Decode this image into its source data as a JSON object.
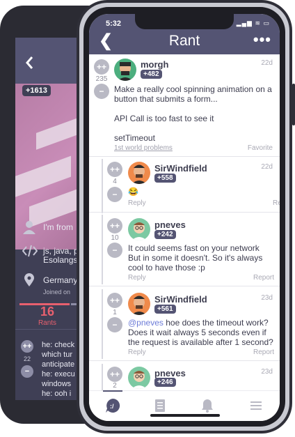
{
  "back_screen": {
    "badge": "+1613",
    "rows": [
      {
        "icon": "user-icon",
        "text": "I'm from"
      },
      {
        "icon": "code-icon",
        "text": "js, java, p"
      },
      {
        "icon": "none",
        "text": "Esolangs"
      },
      {
        "icon": "location-icon",
        "text": "Germany"
      }
    ],
    "joined": "Joined on",
    "rants_count": "16",
    "rants_label": "Rants",
    "comment": {
      "vote_count": "22",
      "lines": [
        "he: check",
        "which tur",
        "anticipate",
        "he: execu",
        "windows",
        "he: ooh i"
      ]
    }
  },
  "status_bar": {
    "time": "5:32",
    "icons": "▂▄▆ ≋ ▭"
  },
  "nav": {
    "back_label": "❮",
    "title": "Rant",
    "more_label": "•••"
  },
  "rant": {
    "upvote": "++",
    "downvote": "−",
    "votes": "235",
    "username": "morgh",
    "score": "+482",
    "date": "22d",
    "text": "Make a really cool spinning animation on a\nbutton that submits a form...\n\nAPI Call is too fast to see it\n\nsetTimeout",
    "tag": "1st world problems",
    "favorite": "Favorite"
  },
  "comments": [
    {
      "username": "SirWindfield",
      "score": "+558",
      "date": "22d",
      "votes": "4",
      "text": "😂",
      "reply": "Reply",
      "report": "Report",
      "avatar": "sirwindfield"
    },
    {
      "username": "pneves",
      "score": "+242",
      "date": "",
      "votes": "10",
      "text": "It could seems fast on your network\nBut in some it doesn't. So it's always\ncool to have those :p",
      "reply": "Reply",
      "report": "Report",
      "avatar": "pneves"
    },
    {
      "username": "SirWindfield",
      "score": "+561",
      "date": "23d",
      "votes": "1",
      "mention": "@pneves",
      "text": " hoe does the timeout work?\nDoes it wait always 5 seconds even if\nthe request is available after 1 second?",
      "reply": "Reply",
      "report": "Report",
      "avatar": "sirwindfield"
    },
    {
      "username": "pneves",
      "score": "+246",
      "date": "23d",
      "votes": "2",
      "text": "",
      "reply": "",
      "report": "",
      "avatar": "pneves"
    }
  ],
  "tabbar": {
    "items": [
      "rants-tab",
      "stories-tab",
      "notifications-tab",
      "menu-tab"
    ]
  },
  "colors": {
    "nav": "#545473",
    "accent": "#e8606e",
    "vote": "#b9b9c4"
  }
}
